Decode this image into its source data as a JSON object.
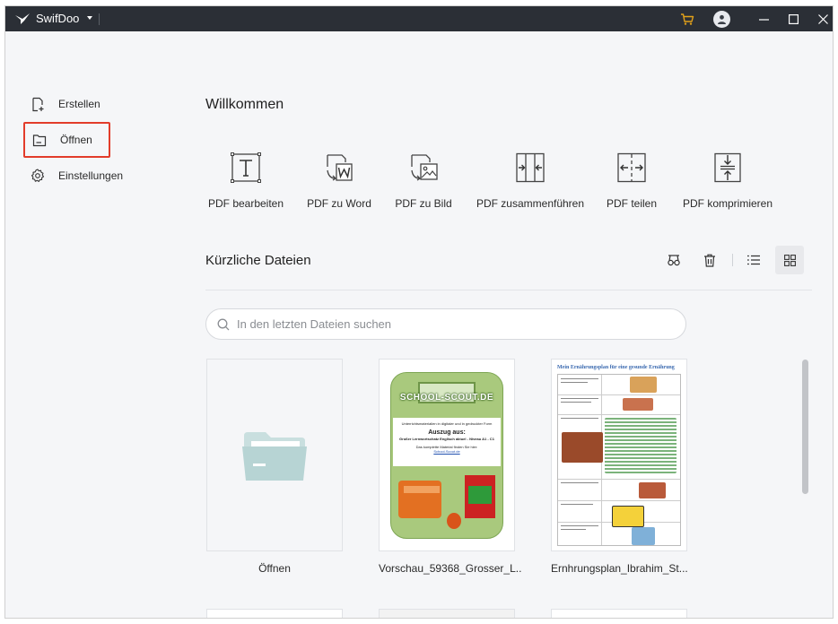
{
  "titlebar": {
    "app_name": "SwifDoo"
  },
  "sidebar": {
    "items": [
      {
        "label": "Erstellen",
        "icon": "create-file-icon",
        "selected": false
      },
      {
        "label": "Öffnen",
        "icon": "open-file-icon",
        "selected": true
      },
      {
        "label": "Einstellungen",
        "icon": "gear-icon",
        "selected": false
      }
    ]
  },
  "main": {
    "welcome": "Willkommen",
    "tools": [
      {
        "label": "PDF bearbeiten",
        "icon": "edit-text-icon"
      },
      {
        "label": "PDF zu Word",
        "icon": "pdf-to-word-icon"
      },
      {
        "label": "PDF zu Bild",
        "icon": "pdf-to-image-icon"
      },
      {
        "label": "PDF zusammenführen",
        "icon": "merge-icon"
      },
      {
        "label": "PDF teilen",
        "icon": "split-icon"
      },
      {
        "label": "PDF komprimieren",
        "icon": "compress-icon"
      }
    ],
    "recent": {
      "title": "Kürzliche Dateien",
      "actions": [
        {
          "name": "clean-icon"
        },
        {
          "name": "trash-icon"
        },
        {
          "name": "list-view-icon"
        },
        {
          "name": "grid-view-icon",
          "active": true
        }
      ],
      "search_placeholder": "In den letzten Dateien suchen",
      "files": [
        {
          "label": "Öffnen",
          "kind": "open"
        },
        {
          "label": "Vorschau_59368_Grosser_L...",
          "kind": "pdf"
        },
        {
          "label": "Ernhrungsplan_Ibrahim_St...",
          "kind": "pdf"
        }
      ]
    }
  },
  "thumbs": {
    "school": {
      "brand": "SCHOOL-SCOUT.DE",
      "line1": "Unterrichtsmaterialien in digitaler und in gedruckter Form",
      "heading": "Auszug aus:",
      "subtitle": "Großer Lernwortschatz Englisch aktuel - Niveau A1 - C1",
      "line2": "Das komplette Material finden Sie hier:",
      "link": "School-Scout.de"
    },
    "plan": {
      "title": "Mein Ernährungsplan für eine gesunde Ernährung"
    }
  },
  "colors": {
    "titlebar": "#2b2f36",
    "selection_border": "#e23c2a",
    "cart": "#e2a11a",
    "folder": "#b7d4d4"
  }
}
